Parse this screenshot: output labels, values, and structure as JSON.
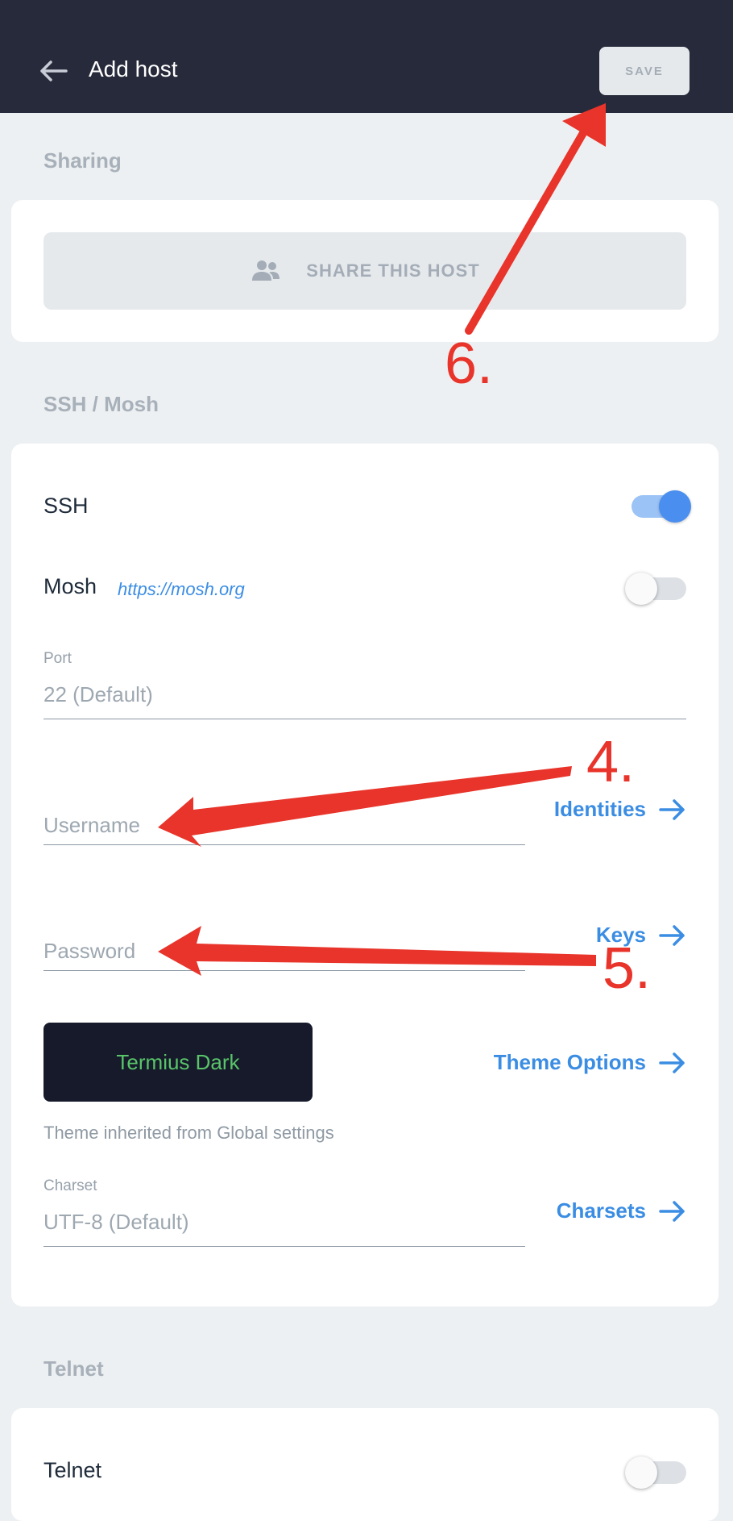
{
  "header": {
    "title": "Add host",
    "save_label": "SAVE"
  },
  "sharing": {
    "heading": "Sharing",
    "share_label": "SHARE THIS HOST"
  },
  "ssh": {
    "heading": "SSH / Mosh",
    "ssh_label": "SSH",
    "ssh_enabled": true,
    "mosh_label": "Mosh",
    "mosh_link": "https://mosh.org",
    "mosh_enabled": false,
    "port_label": "Port",
    "port_placeholder": "22 (Default)",
    "username_placeholder": "Username",
    "identities_link": "Identities",
    "password_placeholder": "Password",
    "keys_link": "Keys",
    "theme_name": "Termius Dark",
    "theme_options_link": "Theme Options",
    "theme_note": "Theme inherited from Global settings",
    "charset_label": "Charset",
    "charset_placeholder": "UTF-8 (Default)",
    "charsets_link": "Charsets"
  },
  "telnet": {
    "heading": "Telnet",
    "telnet_label": "Telnet",
    "telnet_enabled": false
  },
  "annotations": {
    "step6": "6.",
    "step4": "4.",
    "step5": "5."
  },
  "colors": {
    "header_bg": "#272a3a",
    "accent_blue": "#3b8de3",
    "toggle_on": "#4a8ff0",
    "annotation_red": "#e8342a",
    "theme_text_green": "#59c46a"
  },
  "icons": [
    "back-arrow-icon",
    "share-users-icon",
    "arrow-right-icon"
  ]
}
